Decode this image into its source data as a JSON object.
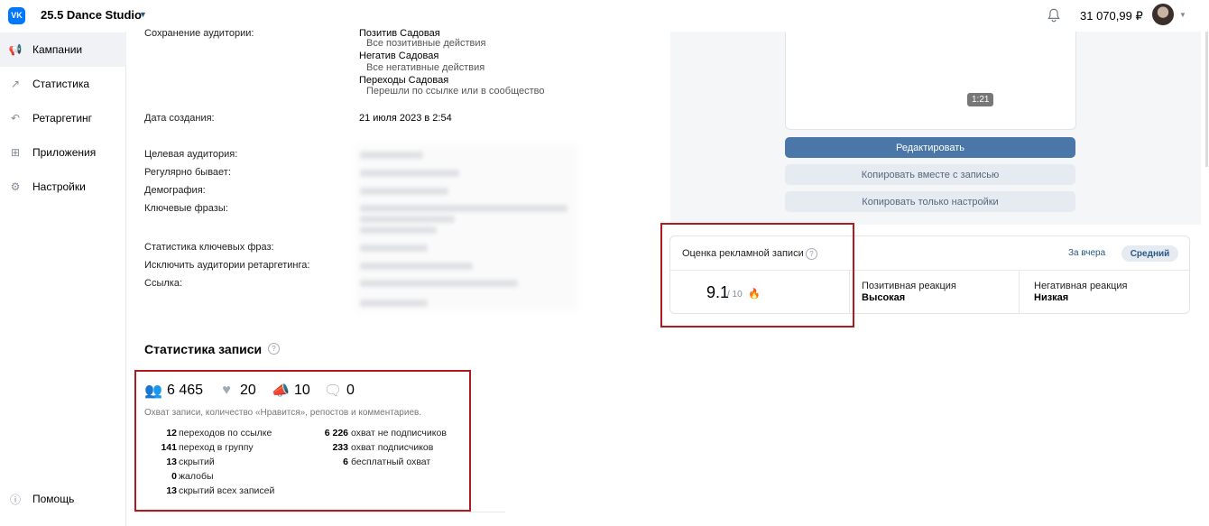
{
  "header": {
    "logo": "VK",
    "brand": "25.5 Dance Studio",
    "balance": "31 070,99 ₽",
    "icons": {
      "bell": "bell-icon",
      "chevron": "chevron-down-icon"
    }
  },
  "sidebar": {
    "items": [
      {
        "label": "Кампании",
        "icon": "megaphone-icon",
        "active": true
      },
      {
        "label": "Статистика",
        "icon": "trend-icon"
      },
      {
        "label": "Ретаргетинг",
        "icon": "retarget-icon"
      },
      {
        "label": "Приложения",
        "icon": "apps-icon"
      },
      {
        "label": "Настройки",
        "icon": "gear-icon"
      }
    ],
    "help": "Помощь"
  },
  "details": {
    "audience_save_label": "Сохранение аудитории:",
    "audiences": [
      {
        "name": "Позитив Садовая",
        "desc": "Все позитивные действия"
      },
      {
        "name": "Негатив Садовая",
        "desc": "Все негативные действия"
      },
      {
        "name": "Переходы Садовая",
        "desc": "Перешли по ссылке или в сообщество"
      }
    ],
    "created_label": "Дата создания:",
    "created_value": "21 июля 2023 в 2:54",
    "fields": [
      "Целевая аудитория:",
      "Регулярно бывает:",
      "Демография:",
      "Ключевые фразы:",
      "Статистика ключевых фраз:",
      "Исключить аудитории ретаргетинга:",
      "Ссылка:"
    ]
  },
  "preview": {
    "duration": "1:21",
    "edit": "Редактировать",
    "copy_with_post": "Копировать вместе с записью",
    "copy_settings": "Копировать только настройки"
  },
  "score": {
    "title": "Оценка рекламной записи",
    "value": "9.1",
    "of": "/ 10",
    "period": "За вчера",
    "level": "Средний",
    "positive_label": "Позитивная реакция",
    "positive_value": "Высокая",
    "negative_label": "Негативная реакция",
    "negative_value": "Низкая"
  },
  "post_stats": {
    "title": "Статистика записи",
    "reach": "6 465",
    "likes": "20",
    "reposts": "10",
    "comments": "0",
    "note": "Охват записи, количество «Нравится», репостов и комментариев.",
    "left": [
      {
        "num": "12",
        "text": "переходов по ссылке"
      },
      {
        "num": "141",
        "text": "переход в группу"
      },
      {
        "num": "13",
        "text": "скрытий"
      },
      {
        "num": "0",
        "text": "жалобы"
      },
      {
        "num": "13",
        "text": "скрытий всех записей"
      }
    ],
    "right": [
      {
        "num": "6 226",
        "text": "охват не подписчиков"
      },
      {
        "num": "233",
        "text": "охват подписчиков"
      },
      {
        "num": "6",
        "text": "бесплатный охват"
      }
    ]
  }
}
